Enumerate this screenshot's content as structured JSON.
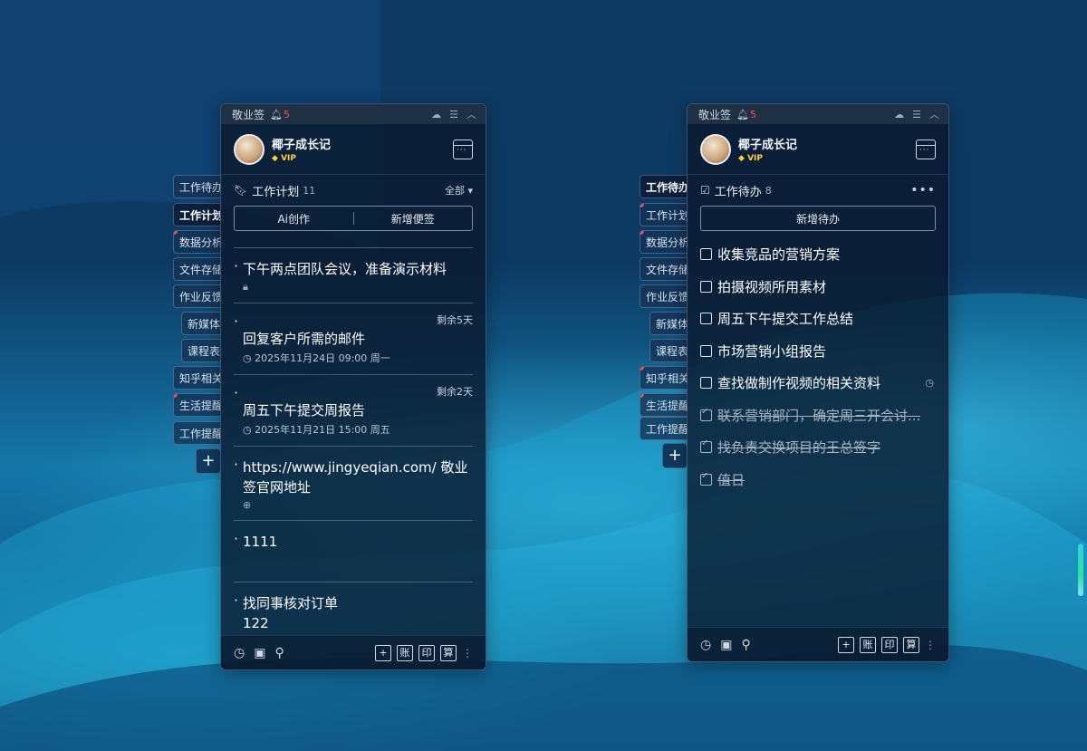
{
  "left_window": {
    "brand": "敬业签",
    "notif_count": "5",
    "profile": {
      "name": "椰子成长记",
      "vip": "VIP"
    },
    "section": {
      "title": "工作计划",
      "count": "11",
      "filter": "全部 ▾"
    },
    "buttons": {
      "ai": "Ai创作",
      "new_note": "新增便签"
    },
    "notes": [
      {
        "title": "下午两点团队会议，准备演示材料",
        "meta": "",
        "remain": "",
        "icon": "🔒"
      },
      {
        "title": "回复客户所需的邮件",
        "meta": "2025年11月24日 09:00 周一",
        "remain": "剩余5天",
        "icon": ""
      },
      {
        "title": "周五下午提交周报告",
        "meta": "2025年11月21日 15:00 周五",
        "remain": "剩余2天",
        "icon": ""
      },
      {
        "title": " https://www.jingyeqian.com/ 敬业签官网地址",
        "meta": "",
        "remain": "",
        "icon": "🌐"
      },
      {
        "title": "1111",
        "meta": "",
        "remain": "",
        "icon": ""
      },
      {
        "title": "找同事核对订单\n122",
        "meta": "",
        "remain": "",
        "icon": ""
      }
    ],
    "side_tabs": [
      "工作待办",
      "工作计划",
      "数据分析",
      "文件存储",
      "作业反馈",
      "新媒体",
      "课程表",
      "知乎相关",
      "生活提醒",
      "工作提醒"
    ],
    "toolbar": {
      "acct": "账",
      "print": "印",
      "calc": "算",
      "add": "+"
    }
  },
  "right_window": {
    "brand": "敬业签",
    "notif_count": "5",
    "profile": {
      "name": "椰子成长记",
      "vip": "VIP"
    },
    "section": {
      "title": "工作待办",
      "count": "8",
      "more": "•••"
    },
    "buttons": {
      "new_todo": "新增待办"
    },
    "todos": [
      {
        "label": "收集竞品的营销方案",
        "done": false
      },
      {
        "label": "拍摄视频所用素材",
        "done": false
      },
      {
        "label": "周五下午提交工作总结",
        "done": false
      },
      {
        "label": "市场营销小组报告",
        "done": false
      },
      {
        "label": "查找做制作视频的相关资料",
        "done": false,
        "clock": true
      },
      {
        "label": "联系营销部门，确定周三开会讨...",
        "done": true
      },
      {
        "label": "找负责交换项目的王总签字",
        "done": true
      },
      {
        "label": "值日",
        "done": true
      }
    ],
    "side_tabs": [
      "工作待办",
      "工作计划",
      "数据分析",
      "文件存储",
      "作业反馈",
      "新媒体",
      "课程表",
      "知乎相关",
      "生活提醒",
      "工作提醒"
    ],
    "toolbar": {
      "acct": "账",
      "print": "印",
      "calc": "算",
      "add": "+"
    }
  },
  "colors": {
    "accent_red": "#ff4d4d",
    "vip_gold": "#ffd23a"
  },
  "icons": [
    "bell-icon",
    "cloud-icon",
    "menu-icon",
    "collapse-icon",
    "calendar-icon",
    "bookmark-icon",
    "clock-icon",
    "archive-icon",
    "search-icon",
    "plus-icon",
    "lock-icon",
    "web-icon",
    "checkbox-icon"
  ]
}
